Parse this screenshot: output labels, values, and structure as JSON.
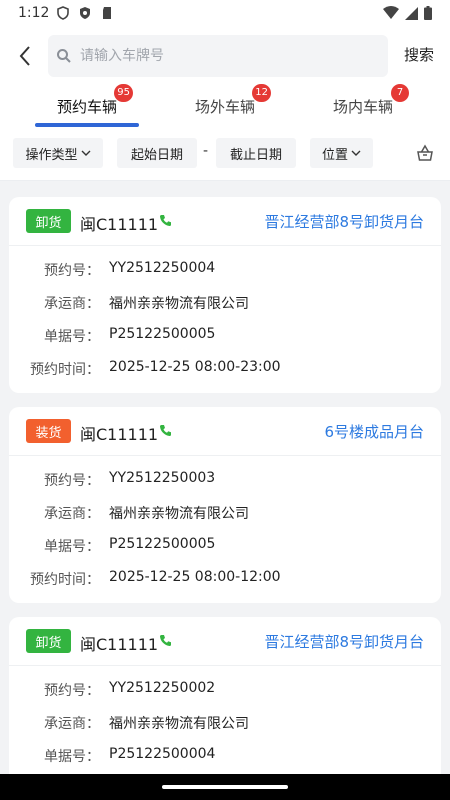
{
  "status_bar": {
    "time": "1:12"
  },
  "header": {
    "search_placeholder": "请输入车牌号",
    "search_button": "搜索"
  },
  "tabs": [
    {
      "label": "预约车辆",
      "badge": "95",
      "active": true
    },
    {
      "label": "场外车辆",
      "badge": "12",
      "active": false
    },
    {
      "label": "场内车辆",
      "badge": "7",
      "active": false
    }
  ],
  "filters": {
    "operation_type": "操作类型",
    "start_date": "起始日期",
    "separator": "-",
    "end_date": "截止日期",
    "location": "位置"
  },
  "field_labels": {
    "appointment_no": "预约号：",
    "carrier": "承运商：",
    "document_no": "单据号：",
    "appointment_time": "预约时间："
  },
  "colors": {
    "accent": "#2f66d6",
    "unload_tag": "#33b440",
    "load_tag": "#f2602e",
    "badge": "#e53935",
    "dock_text": "#2d7ae0"
  },
  "cards": [
    {
      "type": "卸货",
      "type_color": "#33b440",
      "plate": "闽C11111",
      "dock": "晋江经营部8号卸货月台",
      "appointment_no": "YY2512250004",
      "carrier": "福州亲亲物流有限公司",
      "document_no": "P25122500005",
      "appointment_time": "2025-12-25 08:00-23:00"
    },
    {
      "type": "装货",
      "type_color": "#f2602e",
      "plate": "闽C11111",
      "dock": "6号楼成品月台",
      "appointment_no": "YY2512250003",
      "carrier": "福州亲亲物流有限公司",
      "document_no": "P25122500005",
      "appointment_time": "2025-12-25 08:00-12:00"
    },
    {
      "type": "卸货",
      "type_color": "#33b440",
      "plate": "闽C11111",
      "dock": "晋江经营部8号卸货月台",
      "appointment_no": "YY2512250002",
      "carrier": "福州亲亲物流有限公司",
      "document_no": "P25122500004",
      "appointment_time": ""
    }
  ]
}
